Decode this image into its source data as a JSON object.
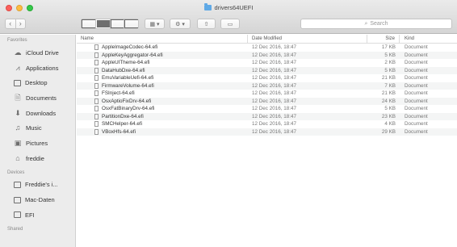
{
  "window": {
    "title": "drivers64UEFI"
  },
  "toolbar": {
    "back_icon": "‹",
    "forward_icon": "›",
    "search_placeholder": "Search",
    "action_menu_icon": "gear-icon",
    "arrange_icon": "grid-icon"
  },
  "sidebar": {
    "favorites_header": "Favorites",
    "favorites": [
      {
        "label": "iCloud Drive",
        "icon": "cloud-icon"
      },
      {
        "label": "Applications",
        "icon": "applications-icon"
      },
      {
        "label": "Desktop",
        "icon": "desktop-icon"
      },
      {
        "label": "Documents",
        "icon": "documents-icon"
      },
      {
        "label": "Downloads",
        "icon": "downloads-icon"
      },
      {
        "label": "Music",
        "icon": "music-icon"
      },
      {
        "label": "Pictures",
        "icon": "pictures-icon"
      },
      {
        "label": "freddie",
        "icon": "home-icon"
      }
    ],
    "devices_header": "Devices",
    "devices": [
      {
        "label": "Freddie's i...",
        "icon": "computer-icon"
      },
      {
        "label": "Mac-Daten",
        "icon": "disk-icon"
      },
      {
        "label": "EFI",
        "icon": "disk-icon"
      }
    ],
    "shared_header": "Shared"
  },
  "columns": {
    "name": "Name",
    "date": "Date Modified",
    "size": "Size",
    "kind": "Kind"
  },
  "files": [
    {
      "name": "AppleImageCodec-64.efi",
      "date": "12 Dec 2016, 18:47",
      "size": "17 KB",
      "kind": "Document"
    },
    {
      "name": "AppleKeyAggregator-64.efi",
      "date": "12 Dec 2016, 18:47",
      "size": "5 KB",
      "kind": "Document"
    },
    {
      "name": "AppleUITheme-64.efi",
      "date": "12 Dec 2016, 18:47",
      "size": "2 KB",
      "kind": "Document"
    },
    {
      "name": "DataHubDxe-64.efi",
      "date": "12 Dec 2016, 18:47",
      "size": "5 KB",
      "kind": "Document"
    },
    {
      "name": "EmuVariableUefi-64.efi",
      "date": "12 Dec 2016, 18:47",
      "size": "21 KB",
      "kind": "Document"
    },
    {
      "name": "FirmwareVolume-64.efi",
      "date": "12 Dec 2016, 18:47",
      "size": "7 KB",
      "kind": "Document"
    },
    {
      "name": "FSInject-64.efi",
      "date": "12 Dec 2016, 18:47",
      "size": "21 KB",
      "kind": "Document"
    },
    {
      "name": "OsxAptioFixDrv-64.efi",
      "date": "12 Dec 2016, 18:47",
      "size": "24 KB",
      "kind": "Document"
    },
    {
      "name": "OsxFatBinaryDrv-64.efi",
      "date": "12 Dec 2016, 18:47",
      "size": "5 KB",
      "kind": "Document"
    },
    {
      "name": "PartitionDxe-64.efi",
      "date": "12 Dec 2016, 18:47",
      "size": "23 KB",
      "kind": "Document"
    },
    {
      "name": "SMCHelper-64.efi",
      "date": "12 Dec 2016, 18:47",
      "size": "4 KB",
      "kind": "Document"
    },
    {
      "name": "VBoxHfs-64.efi",
      "date": "12 Dec 2016, 18:47",
      "size": "29 KB",
      "kind": "Document"
    }
  ]
}
